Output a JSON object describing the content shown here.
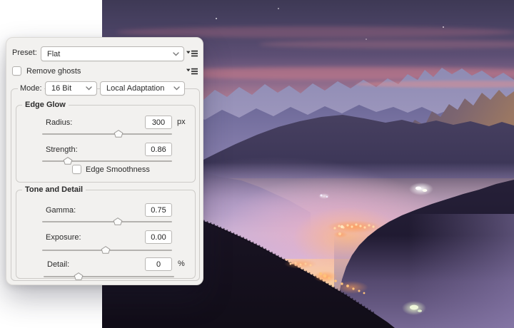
{
  "dialog": {
    "preset": {
      "label": "Preset:",
      "value": "Flat"
    },
    "remove_ghosts": {
      "label": "Remove ghosts",
      "checked": false
    },
    "mode": {
      "label": "Mode:",
      "bit_depth": "16 Bit",
      "method": "Local Adaptation"
    },
    "edge_glow": {
      "legend": "Edge Glow",
      "radius": {
        "label": "Radius:",
        "value": "300",
        "unit": "px",
        "slider_pct": 59
      },
      "strength": {
        "label": "Strength:",
        "value": "0.86",
        "slider_pct": 20
      },
      "edge_smoothness": {
        "label": "Edge Smoothness",
        "checked": false
      }
    },
    "tone_and_detail": {
      "legend": "Tone and Detail",
      "gamma": {
        "label": "Gamma:",
        "value": "0.75",
        "slider_pct": 58
      },
      "exposure": {
        "label": "Exposure:",
        "value": "0.00",
        "slider_pct": 49
      },
      "detail": {
        "label": "Detail:",
        "value": "0",
        "unit": "%",
        "slider_pct": 27
      }
    }
  },
  "photo": {
    "description": "Dusk mountain landscape: purple-pink sunset sky, layered silhouetted ridges, violet valley fog and glowing village lights on dark forested slopes",
    "palette": {
      "sky_top": "#3e3955",
      "sky_pink": "#ee9f96",
      "sky_peach": "#f9cb9c",
      "ridge_far": "#8e8bb3",
      "fog": "#bda4d6",
      "forest_dark": "#16111e",
      "village_light": "#ffb36b"
    }
  }
}
